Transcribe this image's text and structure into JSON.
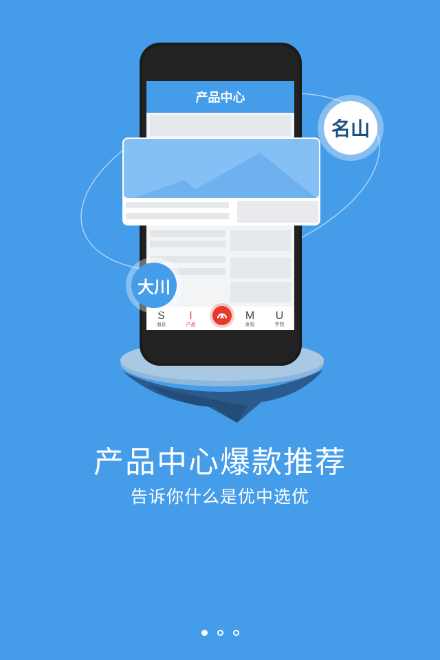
{
  "phone": {
    "app_title": "产品中心",
    "tabs": [
      {
        "glyph": "S",
        "label": "消息"
      },
      {
        "glyph": "I",
        "label": "产品"
      },
      {
        "glyph": "",
        "label": ""
      },
      {
        "glyph": "M",
        "label": "发现"
      },
      {
        "glyph": "U",
        "label": "学院"
      }
    ]
  },
  "bubbles": {
    "top_right": "名山",
    "bottom_left": "大川"
  },
  "headline": "产品中心爆款推荐",
  "subheadline": "告诉你什么是优中选优",
  "pager": {
    "total": 3,
    "active": 1
  },
  "colors": {
    "background": "#459ce9",
    "accent_red": "#e63a2d",
    "island_dark": "#2b5b8c"
  }
}
